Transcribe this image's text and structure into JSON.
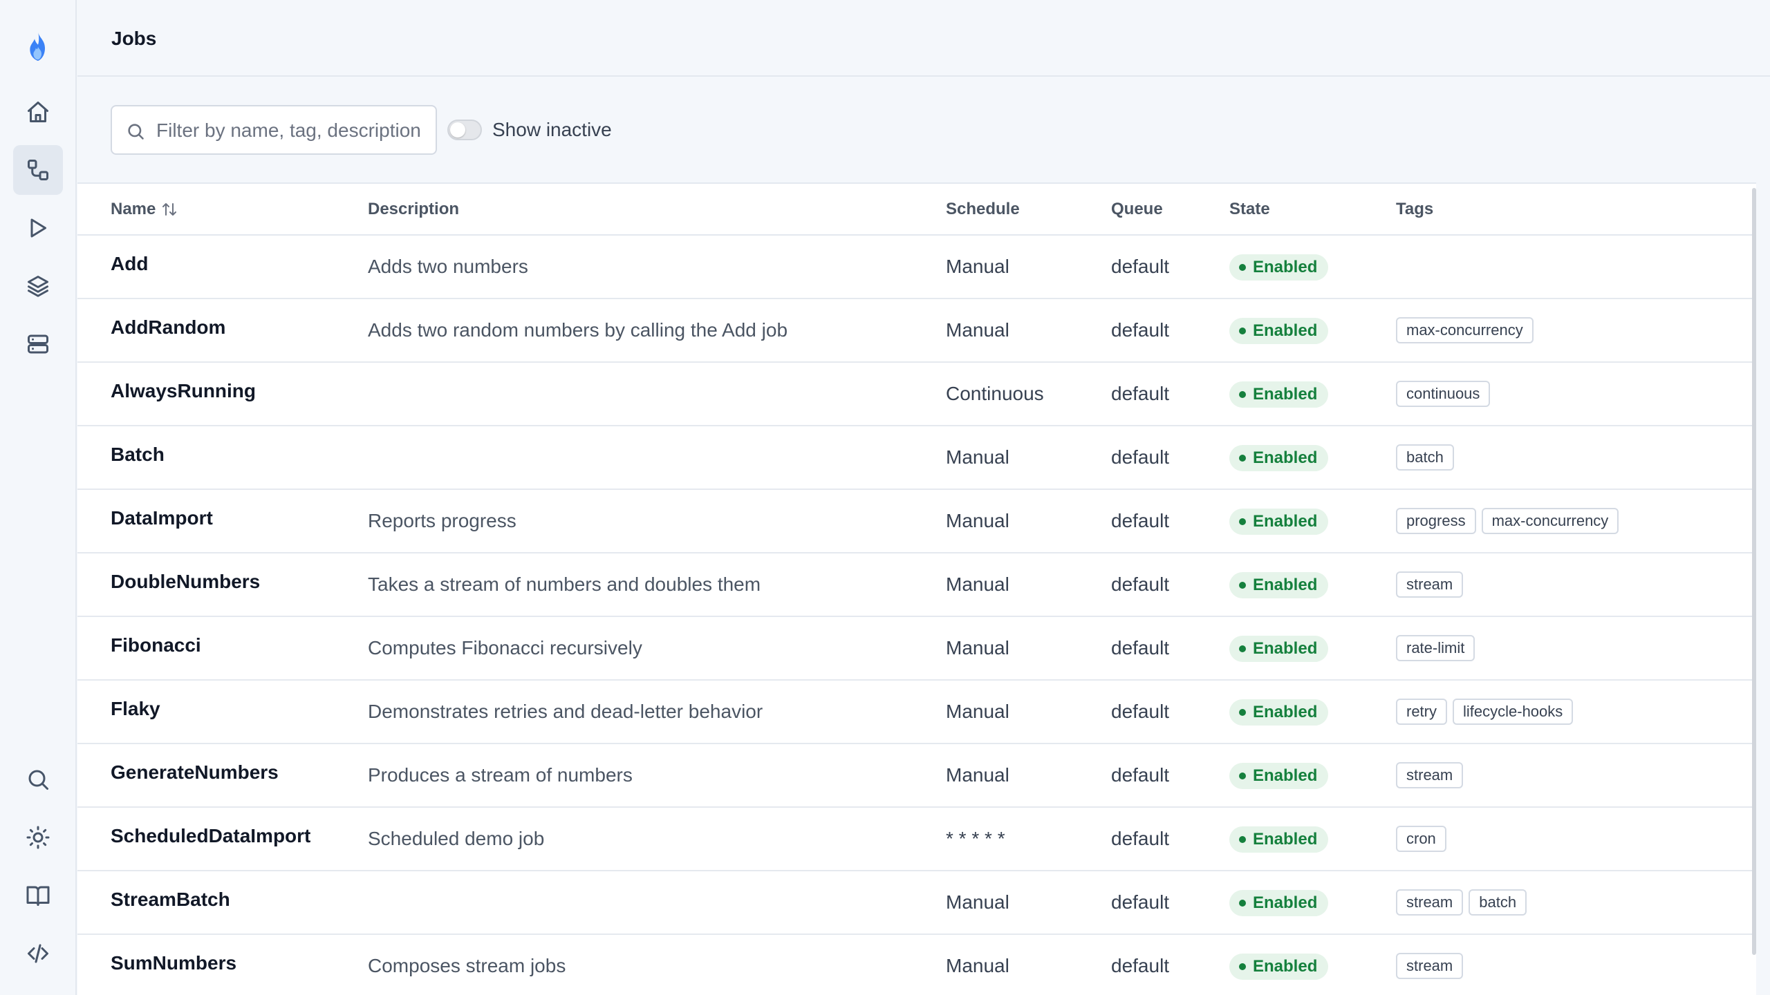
{
  "header": {
    "title": "Jobs"
  },
  "colors": {
    "accent": "#3b82f6",
    "enabled_bg": "#e6f4ea",
    "enabled_fg": "#15803d"
  },
  "sidebar": {
    "logo_icon": "flame-icon",
    "top_items": [
      {
        "icon": "home-icon",
        "active": false
      },
      {
        "icon": "jobs-icon",
        "active": true
      },
      {
        "icon": "play-icon",
        "active": false
      },
      {
        "icon": "layers-icon",
        "active": false
      },
      {
        "icon": "server-icon",
        "active": false
      }
    ],
    "bottom_items": [
      {
        "icon": "search-icon"
      },
      {
        "icon": "sun-icon"
      },
      {
        "icon": "book-icon"
      },
      {
        "icon": "code-icon"
      }
    ]
  },
  "toolbar": {
    "search_placeholder": "Filter by name, tag, description",
    "show_inactive_label": "Show inactive",
    "show_inactive": false
  },
  "table": {
    "columns": {
      "name": "Name",
      "description": "Description",
      "schedule": "Schedule",
      "queue": "Queue",
      "state": "State",
      "tags": "Tags"
    },
    "rows": [
      {
        "name": "Add",
        "description": "Adds two numbers",
        "schedule": "Manual",
        "queue": "default",
        "state": "Enabled",
        "tags": []
      },
      {
        "name": "AddRandom",
        "description": "Adds two random numbers by calling the Add job",
        "schedule": "Manual",
        "queue": "default",
        "state": "Enabled",
        "tags": [
          "max-concurrency"
        ]
      },
      {
        "name": "AlwaysRunning",
        "description": "",
        "schedule": "Continuous",
        "queue": "default",
        "state": "Enabled",
        "tags": [
          "continuous"
        ]
      },
      {
        "name": "Batch",
        "description": "",
        "schedule": "Manual",
        "queue": "default",
        "state": "Enabled",
        "tags": [
          "batch"
        ]
      },
      {
        "name": "DataImport",
        "description": "Reports progress",
        "schedule": "Manual",
        "queue": "default",
        "state": "Enabled",
        "tags": [
          "progress",
          "max-concurrency"
        ]
      },
      {
        "name": "DoubleNumbers",
        "description": "Takes a stream of numbers and doubles them",
        "schedule": "Manual",
        "queue": "default",
        "state": "Enabled",
        "tags": [
          "stream"
        ]
      },
      {
        "name": "Fibonacci",
        "description": "Computes Fibonacci recursively",
        "schedule": "Manual",
        "queue": "default",
        "state": "Enabled",
        "tags": [
          "rate-limit"
        ]
      },
      {
        "name": "Flaky",
        "description": "Demonstrates retries and dead-letter behavior",
        "schedule": "Manual",
        "queue": "default",
        "state": "Enabled",
        "tags": [
          "retry",
          "lifecycle-hooks"
        ]
      },
      {
        "name": "GenerateNumbers",
        "description": "Produces a stream of numbers",
        "schedule": "Manual",
        "queue": "default",
        "state": "Enabled",
        "tags": [
          "stream"
        ]
      },
      {
        "name": "ScheduledDataImport",
        "description": "Scheduled demo job",
        "schedule": "* * * * *",
        "queue": "default",
        "state": "Enabled",
        "tags": [
          "cron"
        ]
      },
      {
        "name": "StreamBatch",
        "description": "",
        "schedule": "Manual",
        "queue": "default",
        "state": "Enabled",
        "tags": [
          "stream",
          "batch"
        ]
      },
      {
        "name": "SumNumbers",
        "description": "Composes stream jobs",
        "schedule": "Manual",
        "queue": "default",
        "state": "Enabled",
        "tags": [
          "stream"
        ]
      }
    ]
  }
}
